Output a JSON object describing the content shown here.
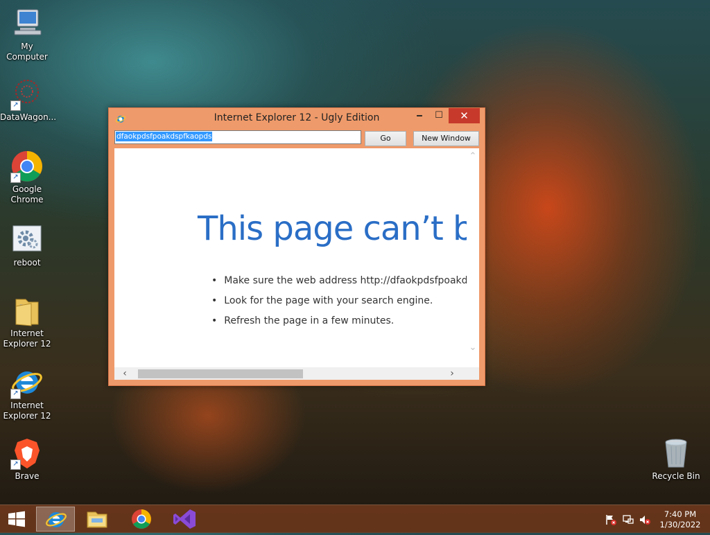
{
  "desktop": {
    "icons": [
      {
        "label": "My Computer",
        "icon": "computer-icon"
      },
      {
        "label": "DataWagon...",
        "icon": "datawagon-icon"
      },
      {
        "label": "Google Chrome",
        "icon": "chrome-icon"
      },
      {
        "label": "reboot",
        "icon": "gear-icon"
      },
      {
        "label": "Internet Explorer 12",
        "icon": "folder-icon"
      },
      {
        "label": "Internet Explorer 12",
        "icon": "ie-icon"
      },
      {
        "label": "Brave",
        "icon": "brave-icon"
      },
      {
        "label": "Recycle Bin",
        "icon": "recycle-bin-icon"
      }
    ]
  },
  "window": {
    "title": "Internet Explorer 12 - Ugly Edition",
    "minimize": "🗕",
    "maximize": "☐",
    "close": "✕",
    "address_value": "dfaokpdsfpoakdspfkaopds",
    "go_label": "Go",
    "new_window_label": "New Window"
  },
  "page": {
    "heading": "This page can’t be",
    "bullets": [
      "Make sure the web address http://dfaokpdsfpoakdsp",
      "Look for the page with your search engine.",
      "Refresh the page in a few minutes."
    ]
  },
  "taskbar": {
    "items": [
      "start-icon",
      "ie-icon",
      "file-explorer-icon",
      "chrome-icon",
      "visual-studio-icon"
    ],
    "clock_time": "7:40 PM",
    "clock_date": "1/30/2022"
  },
  "colors": {
    "window_frame": "#ef9a6a",
    "close_button": "#c7392b",
    "heading_blue": "#2a6ec6",
    "selection": "#3399ff"
  }
}
